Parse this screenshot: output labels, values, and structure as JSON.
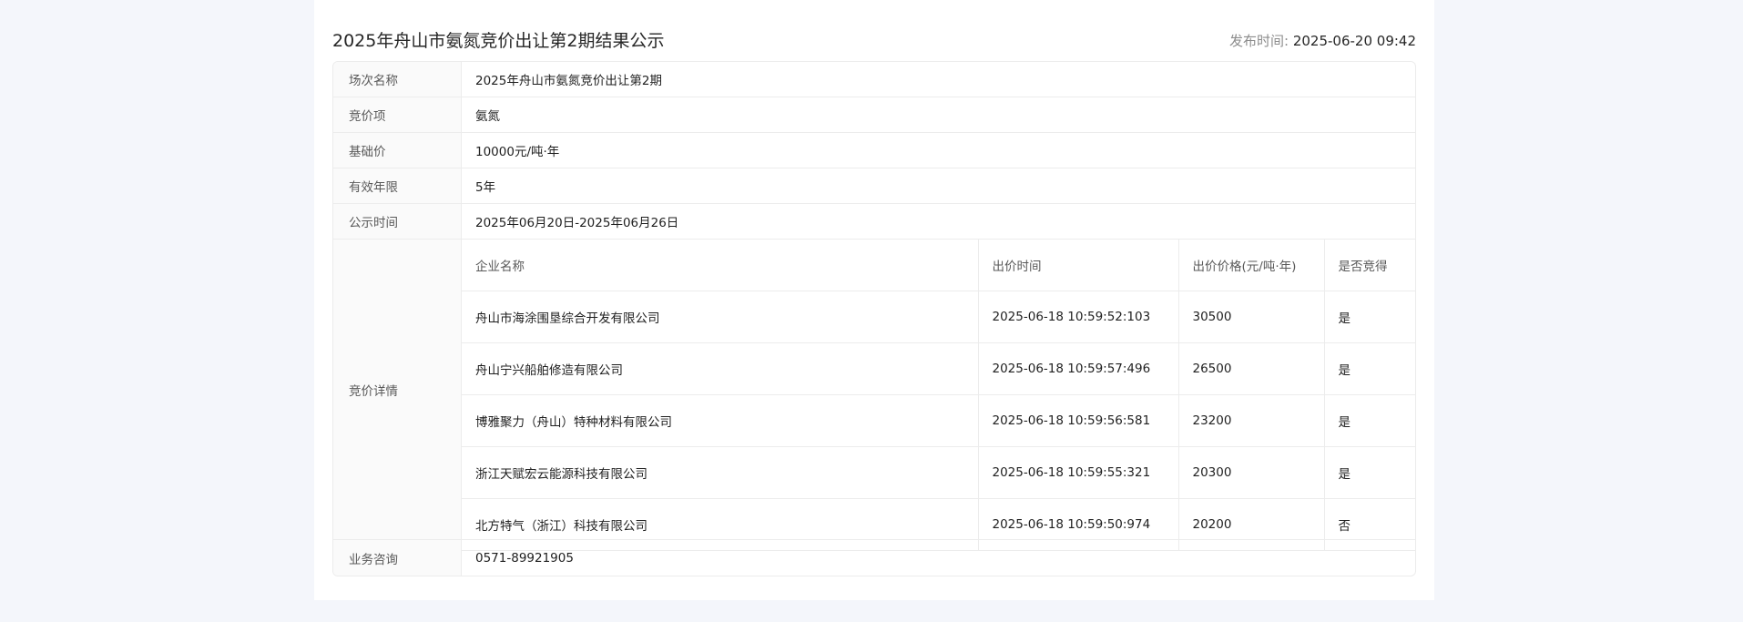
{
  "header": {
    "title": "2025年舟山市氨氮竞价出让第2期结果公示",
    "publish_label": "发布时间:",
    "publish_value": "2025-06-20 09:42"
  },
  "info": {
    "session_label": "场次名称",
    "session_value": "2025年舟山市氨氮竞价出让第2期",
    "item_label": "竞价项",
    "item_value": "氨氮",
    "base_price_label": "基础价",
    "base_price_value": "10000元/吨·年",
    "validity_label": "有效年限",
    "validity_value": "5年",
    "notice_label": "公示时间",
    "notice_value": "2025年06月20日-2025年06月26日",
    "details_label": "竞价详情",
    "consult_label": "业务咨询",
    "consult_value": "0571-89921905"
  },
  "bids": {
    "columns": [
      "企业名称",
      "出价时间",
      "出价价格(元/吨·年)",
      "是否竞得"
    ],
    "rows": [
      {
        "company": "舟山市海涂围垦综合开发有限公司",
        "time": "2025-06-18 10:59:52:103",
        "price": "30500",
        "won": "是"
      },
      {
        "company": "舟山宁兴船舶修造有限公司",
        "time": "2025-06-18 10:59:57:496",
        "price": "26500",
        "won": "是"
      },
      {
        "company": "博雅聚力（舟山）特种材料有限公司",
        "time": "2025-06-18 10:59:56:581",
        "price": "23200",
        "won": "是"
      },
      {
        "company": "浙江天赋宏云能源科技有限公司",
        "time": "2025-06-18 10:59:55:321",
        "price": "20300",
        "won": "是"
      },
      {
        "company": "北方特气（浙江）科技有限公司",
        "time": "2025-06-18 10:59:50:974",
        "price": "20200",
        "won": "否"
      }
    ]
  }
}
